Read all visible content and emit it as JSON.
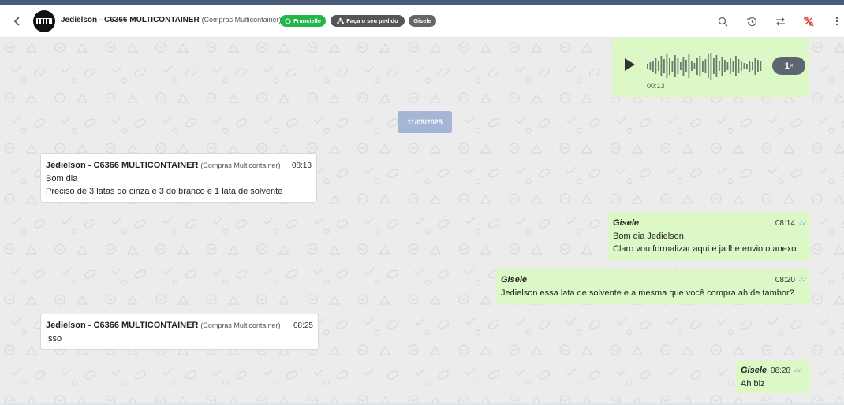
{
  "header": {
    "contact_name": "Jedielson - C6366 MULTICONTAINER",
    "contact_company": "(Compras Multicontainer)",
    "tags": {
      "whatsapp_user": "Francielle",
      "order": "Faça o seu pedido",
      "agent": "Gisele"
    },
    "icons": [
      "back-arrow-icon",
      "search-icon",
      "history-icon",
      "transfer-icon",
      "percent-off-icon",
      "more-vert-icon"
    ]
  },
  "audio": {
    "duration": "00:13",
    "speed": "1",
    "speed_suffix": "x"
  },
  "date_separator": "11/09/2025",
  "messages": [
    {
      "sender": "Jedielson - C6366 MULTICONTAINER",
      "company": "(Compras Multicontainer)",
      "time": "08:13",
      "lines": [
        "Bom dia",
        "Preciso de 3 latas do cinza e 3 do branco e 1 lata de solvente"
      ]
    },
    {
      "sender": "Gisele",
      "time": "08:14",
      "lines": [
        "Bom dia Jedielson.",
        "Claro vou formalizar aqui e ja lhe envio o anexo."
      ]
    },
    {
      "sender": "Gisele",
      "time": "08:20",
      "lines": [
        "Jedielson essa lata de solvente e a mesma que você compra ah de tambor?"
      ]
    },
    {
      "sender": "Jedielson - C6366 MULTICONTAINER",
      "company": "(Compras Multicontainer)",
      "time": "08:25",
      "lines": [
        "Isso"
      ]
    },
    {
      "sender": "Gisele",
      "time": "08:28",
      "lines": [
        "Ah blz"
      ]
    }
  ],
  "colors": {
    "incoming": "#ffffff",
    "outgoing": "#dcf8c6",
    "chat_bg": "#ececec",
    "date_chip": "#a5b5d5",
    "tag_green": "#21b54a",
    "read_check": "#4fc3f7"
  }
}
